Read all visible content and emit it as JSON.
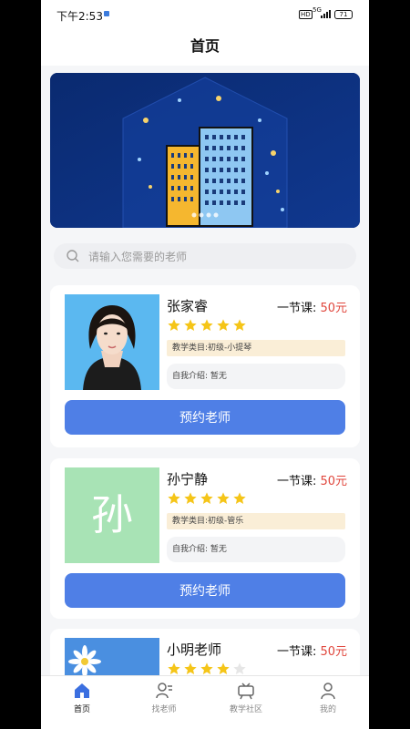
{
  "status_bar": {
    "time": "下午2:53",
    "hd": "HD",
    "network": "5G",
    "battery": "71"
  },
  "header": {
    "title": "首页"
  },
  "search": {
    "placeholder": "请输入您需要的老师"
  },
  "teachers": [
    {
      "name": "张家睿",
      "price_label": "一节课: ",
      "price": "50元",
      "rating": 5,
      "category": "教学类目:初级-小提琴",
      "intro": "自我介绍: 暂无",
      "button": "预约老师",
      "avatar_letter": ""
    },
    {
      "name": "孙宁静",
      "price_label": "一节课: ",
      "price": "50元",
      "rating": 5,
      "category": "教学类目:初级-管乐",
      "intro": "自我介绍: 暂无",
      "button": "预约老师",
      "avatar_letter": "孙"
    },
    {
      "name": "小明老师",
      "price_label": "一节课: ",
      "price": "50元",
      "rating": 4
    }
  ],
  "tabs": [
    {
      "label": "首页",
      "icon": "home-icon",
      "active": true
    },
    {
      "label": "找老师",
      "icon": "find-teacher-icon",
      "active": false
    },
    {
      "label": "教学社区",
      "icon": "community-icon",
      "active": false
    },
    {
      "label": "我的",
      "icon": "profile-icon",
      "active": false
    }
  ],
  "colors": {
    "accent": "#4f7fe6",
    "price": "#e0463c",
    "star": "#f5c518",
    "banner": "#0c2d78",
    "avatar_green": "#a8e3b5"
  }
}
